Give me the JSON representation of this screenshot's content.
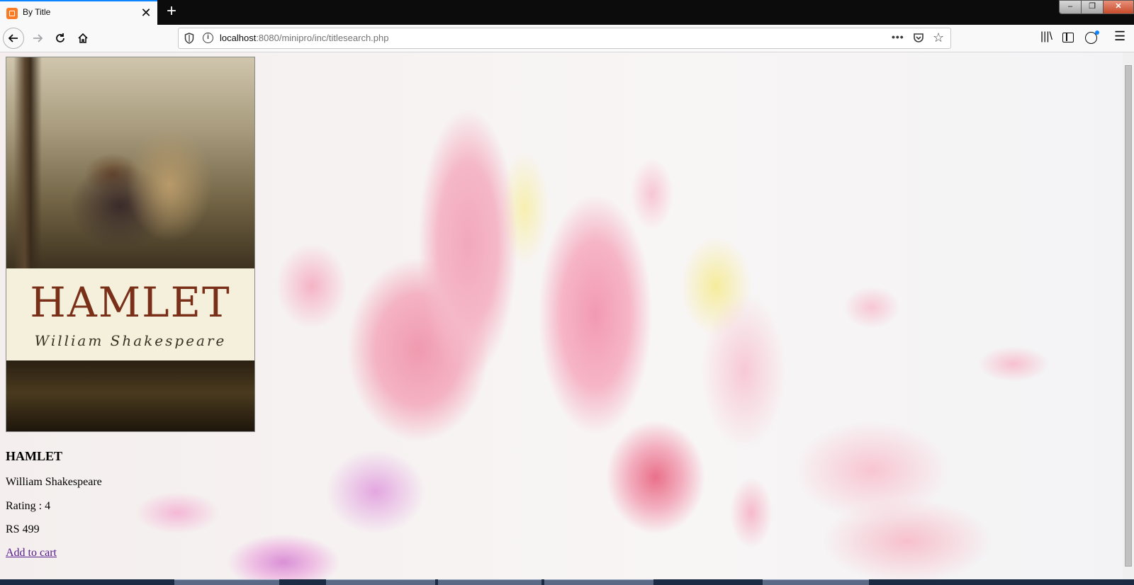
{
  "browser": {
    "tab_title": "By Title",
    "tab_close": "✕",
    "new_tab": "+",
    "url_host": "localhost",
    "url_path": ":8080/minipro/inc/titlesearch.php",
    "url_more": "•••",
    "window_min": "–",
    "window_max": "❐",
    "window_close": "✕"
  },
  "book": {
    "cover_title": "HAMLET",
    "cover_author": "William Shakespeare",
    "title": "HAMLET",
    "author": "William Shakespeare",
    "rating": "Rating : 4",
    "price": "RS 499",
    "add_to_cart": "Add to cart"
  },
  "colors": {
    "accent": "#0a84ff",
    "link_visited": "#551a8b",
    "cover_title": "#7a3018"
  }
}
